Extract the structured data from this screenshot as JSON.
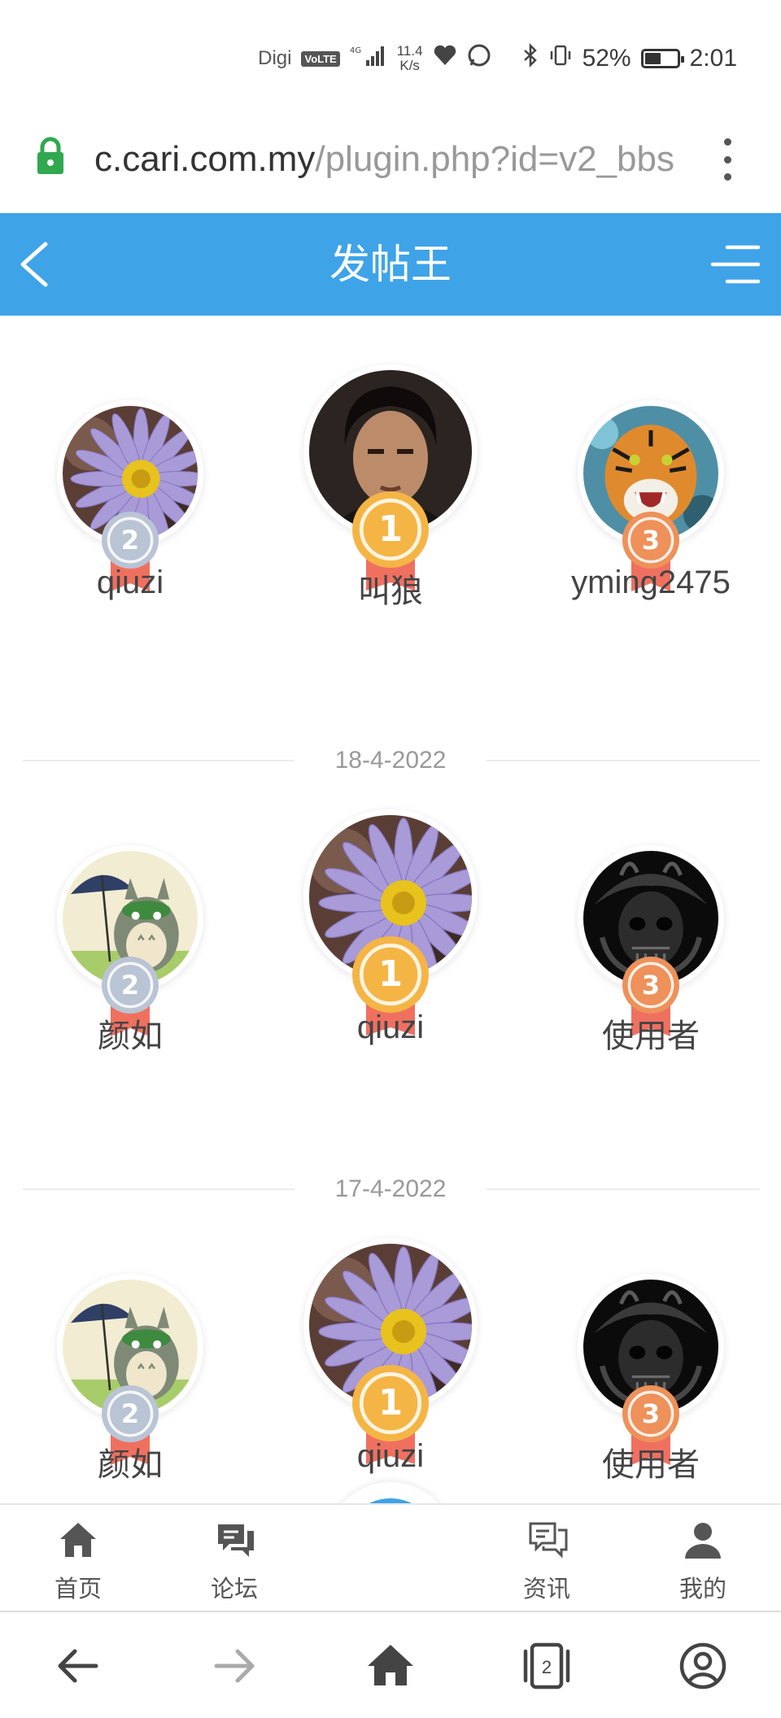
{
  "status_bar": {
    "carrier": "Digi",
    "volte": "VoLTE",
    "network": "4G",
    "speed_value": "11.4",
    "speed_unit": "K/s",
    "battery": "52%",
    "battery_level": 0.52,
    "time": "2:01"
  },
  "browser": {
    "url_host": "c.cari.com.my",
    "url_path": "/plugin.php?id=v2_bbs",
    "tab_count": "2"
  },
  "header": {
    "title": "发帖王"
  },
  "colors": {
    "primary": "#3fa3e8",
    "gold": "#f5b545",
    "silver": "#b9c4d4",
    "bronze": "#ee915a",
    "ribbon": "#f07060"
  },
  "rankings": [
    {
      "date": "",
      "users": [
        {
          "rank": "2",
          "name": "qiuzi",
          "avatar": "flower-avatar"
        },
        {
          "rank": "1",
          "name": "叫狼",
          "avatar": "portrait-avatar"
        },
        {
          "rank": "3",
          "name": "yming2475",
          "avatar": "tiger-avatar"
        }
      ]
    },
    {
      "date": "18-4-2022",
      "users": [
        {
          "rank": "2",
          "name": "颜如",
          "avatar": "totoro-avatar"
        },
        {
          "rank": "1",
          "name": "qiuzi",
          "avatar": "flower-avatar"
        },
        {
          "rank": "3",
          "name": "使用者",
          "avatar": "samurai-avatar"
        }
      ]
    },
    {
      "date": "17-4-2022",
      "users": [
        {
          "rank": "2",
          "name": "颜如",
          "avatar": "totoro-avatar"
        },
        {
          "rank": "1",
          "name": "qiuzi",
          "avatar": "flower-avatar"
        },
        {
          "rank": "3",
          "name": "使用者",
          "avatar": "samurai-avatar"
        }
      ]
    }
  ],
  "bottom_nav": [
    {
      "label": "首页",
      "icon": "home-icon"
    },
    {
      "label": "论坛",
      "icon": "forum-icon"
    },
    {
      "label": "",
      "icon": "apps-icon"
    },
    {
      "label": "资讯",
      "icon": "news-icon"
    },
    {
      "label": "我的",
      "icon": "profile-icon"
    }
  ]
}
